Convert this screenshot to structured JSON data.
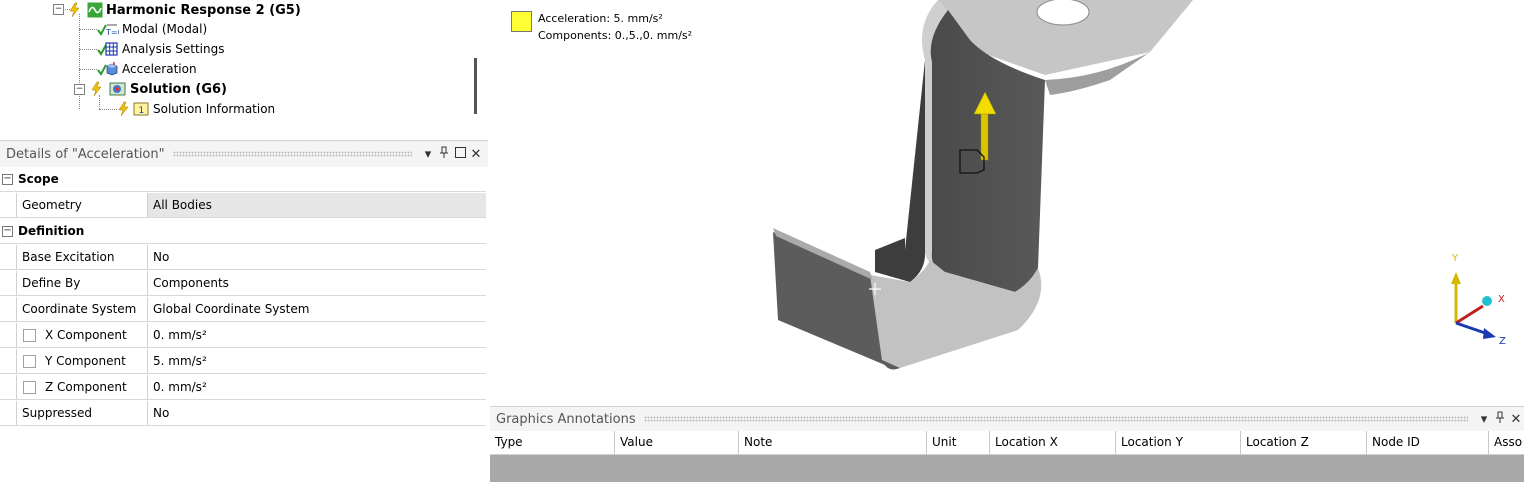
{
  "tree": {
    "harmonic": "Harmonic Response 2 (G5)",
    "modal": "Modal (Modal)",
    "modal_icon_label": "T=0",
    "analysis_settings": "Analysis Settings",
    "acceleration": "Acceleration",
    "solution": "Solution (G6)",
    "solution_info": "Solution Information",
    "solution_info_icon_label": "1"
  },
  "details": {
    "title": "Details of \"Acceleration\"",
    "rows": [
      {
        "label": "Scope"
      },
      {
        "label": "Geometry",
        "value": "All Bodies"
      },
      {
        "label": "Definition"
      },
      {
        "label": "Base Excitation",
        "value": "No"
      },
      {
        "label": "Define By",
        "value": "Components"
      },
      {
        "label": "Coordinate System",
        "value": "Global Coordinate System"
      },
      {
        "label": "X Component",
        "value": "0. mm/s²"
      },
      {
        "label": "Y Component",
        "value": "5. mm/s²"
      },
      {
        "label": "Z Component",
        "value": "0. mm/s²"
      },
      {
        "label": "Suppressed",
        "value": "No"
      }
    ]
  },
  "viewport": {
    "legend_line1": "Acceleration: 5. mm/s²",
    "legend_line2": "Components: 0.,5.,0. mm/s²",
    "legend_color": "#ffff33",
    "triad": {
      "y": "Y",
      "x": "X",
      "z": "Z"
    }
  },
  "annotations": {
    "title": "Graphics Annotations",
    "columns": [
      "Type",
      "Value",
      "Note",
      "Unit",
      "Location X",
      "Location Y",
      "Location Z",
      "Node ID",
      "Asso"
    ]
  },
  "icons": {
    "pin": "pin-icon",
    "maximize": "maximize-icon",
    "close": "close-icon",
    "dropdown": "dropdown-arrow-icon"
  }
}
